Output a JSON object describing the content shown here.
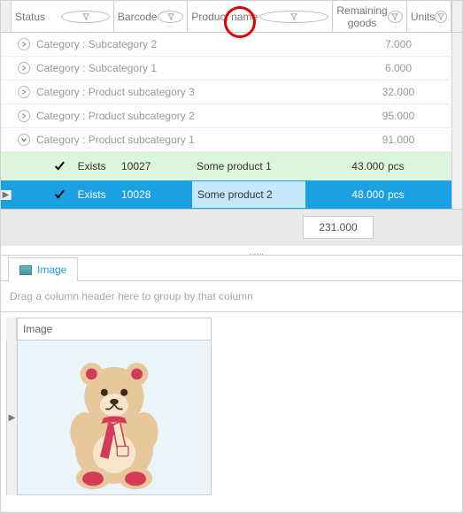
{
  "columns": {
    "status": "Status",
    "barcode": "Barcode",
    "product_name": "Product name",
    "remaining": "Remaining goods",
    "units": "Units"
  },
  "groups": [
    {
      "label": "Category : Subcategory 2",
      "value": "7.000",
      "expanded": false
    },
    {
      "label": "Category : Subcategory 1",
      "value": "6.000",
      "expanded": false
    },
    {
      "label": "Category : Product subcategory 3",
      "value": "32.000",
      "expanded": false
    },
    {
      "label": "Category : Product subcategory 2",
      "value": "95.000",
      "expanded": false
    },
    {
      "label": "Category : Product subcategory 1",
      "value": "91.000",
      "expanded": true
    }
  ],
  "rows": [
    {
      "status": "Exists",
      "barcode": "10027",
      "name": "Some product 1",
      "remaining": "43.000",
      "units": "pcs",
      "selected": false
    },
    {
      "status": "Exists",
      "barcode": "10028",
      "name": "Some product 2",
      "remaining": "48.000",
      "units": "pcs",
      "selected": true
    }
  ],
  "summary": {
    "total": "231.000"
  },
  "detail_tab": {
    "label": "Image"
  },
  "group_placeholder": "Drag a column header here to group by that column",
  "detail_columns": {
    "image": "Image"
  }
}
